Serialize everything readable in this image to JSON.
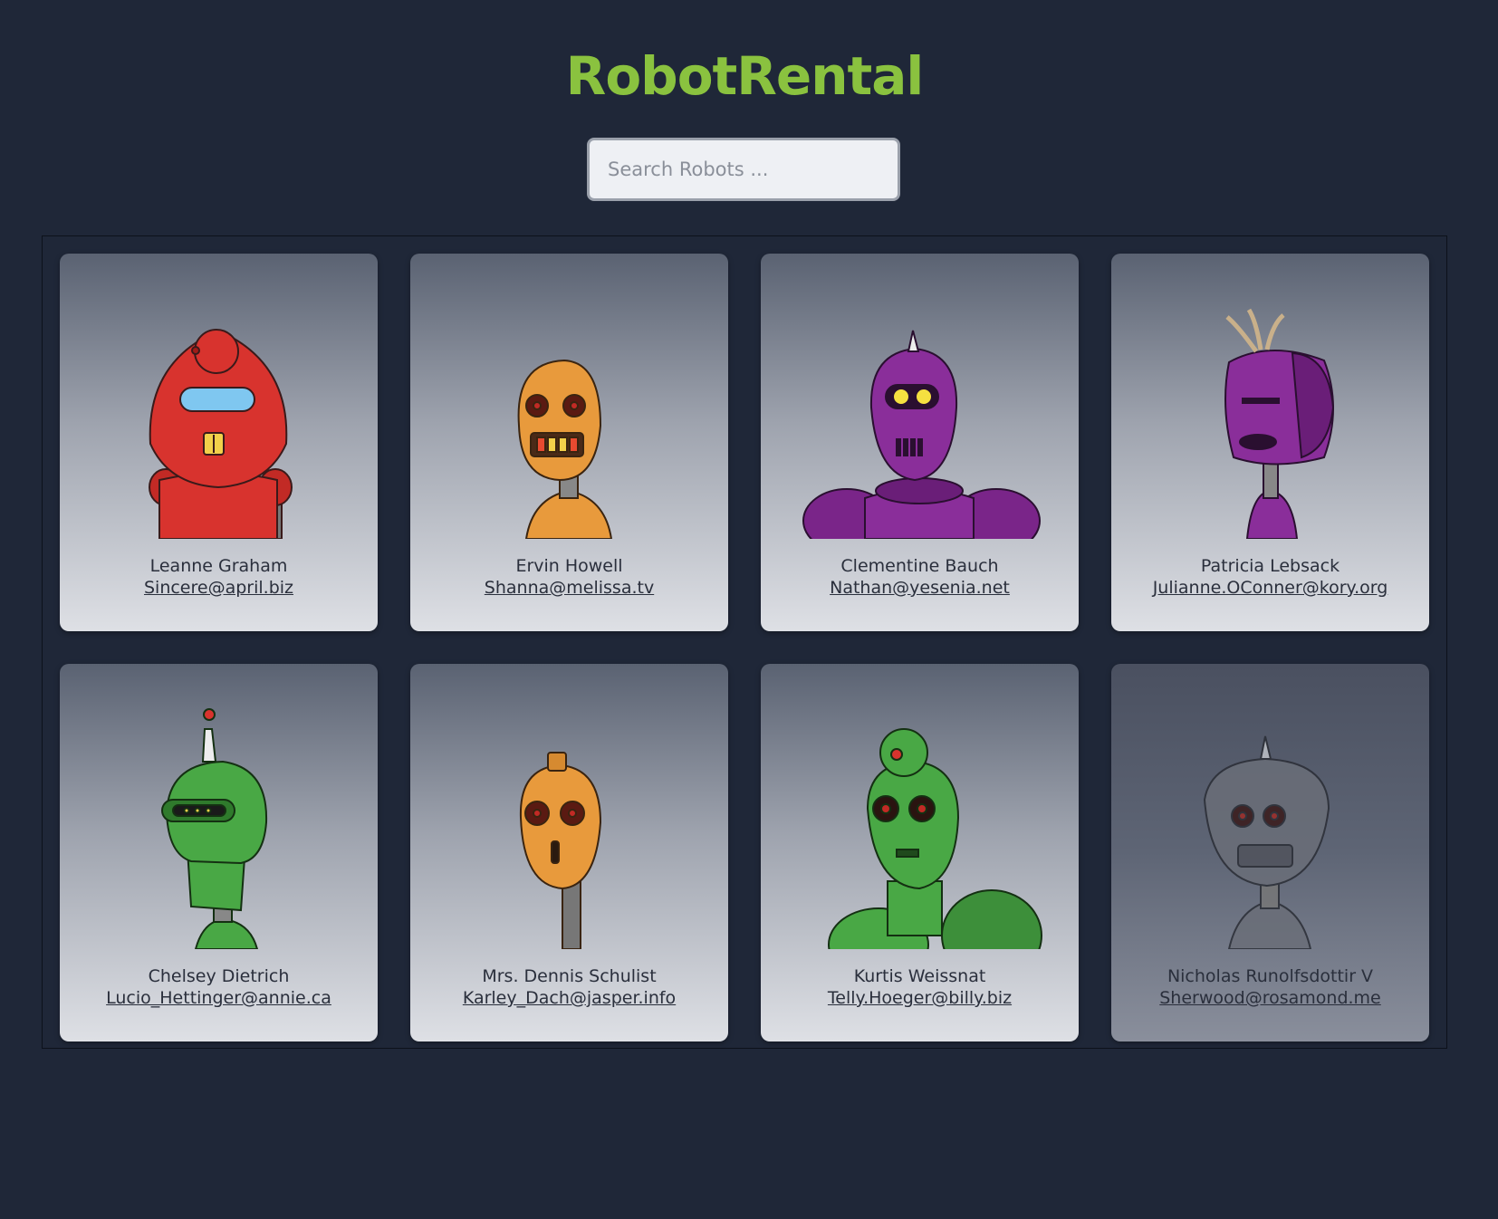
{
  "app_title": "RobotRental",
  "search": {
    "placeholder": "Search Robots ...",
    "value": ""
  },
  "robots": [
    {
      "name": "Leanne Graham",
      "email": "Sincere@april.biz",
      "avatar": "red-robot-avatar"
    },
    {
      "name": "Ervin Howell",
      "email": "Shanna@melissa.tv",
      "avatar": "orange-robot-avatar"
    },
    {
      "name": "Clementine Bauch",
      "email": "Nathan@yesenia.net",
      "avatar": "purple-robot-avatar"
    },
    {
      "name": "Patricia Lebsack",
      "email": "Julianne.OConner@kory.org",
      "avatar": "purple-robot-avatar"
    },
    {
      "name": "Chelsey Dietrich",
      "email": "Lucio_Hettinger@annie.ca",
      "avatar": "green-robot-avatar"
    },
    {
      "name": "Mrs. Dennis Schulist",
      "email": "Karley_Dach@jasper.info",
      "avatar": "orange-robot-avatar"
    },
    {
      "name": "Kurtis Weissnat",
      "email": "Telly.Hoeger@billy.biz",
      "avatar": "green-robot-avatar"
    },
    {
      "name": "Nicholas Runolfsdottir V",
      "email": "Sherwood@rosamond.me",
      "avatar": "gray-robot-avatar"
    }
  ],
  "colors": {
    "background": "#1f2738",
    "title": "#8ac23f",
    "red": "#d8332e",
    "orange": "#e89a3c",
    "purple": "#8a2e9a",
    "green": "#49a845",
    "gray": "#6a6e78"
  }
}
